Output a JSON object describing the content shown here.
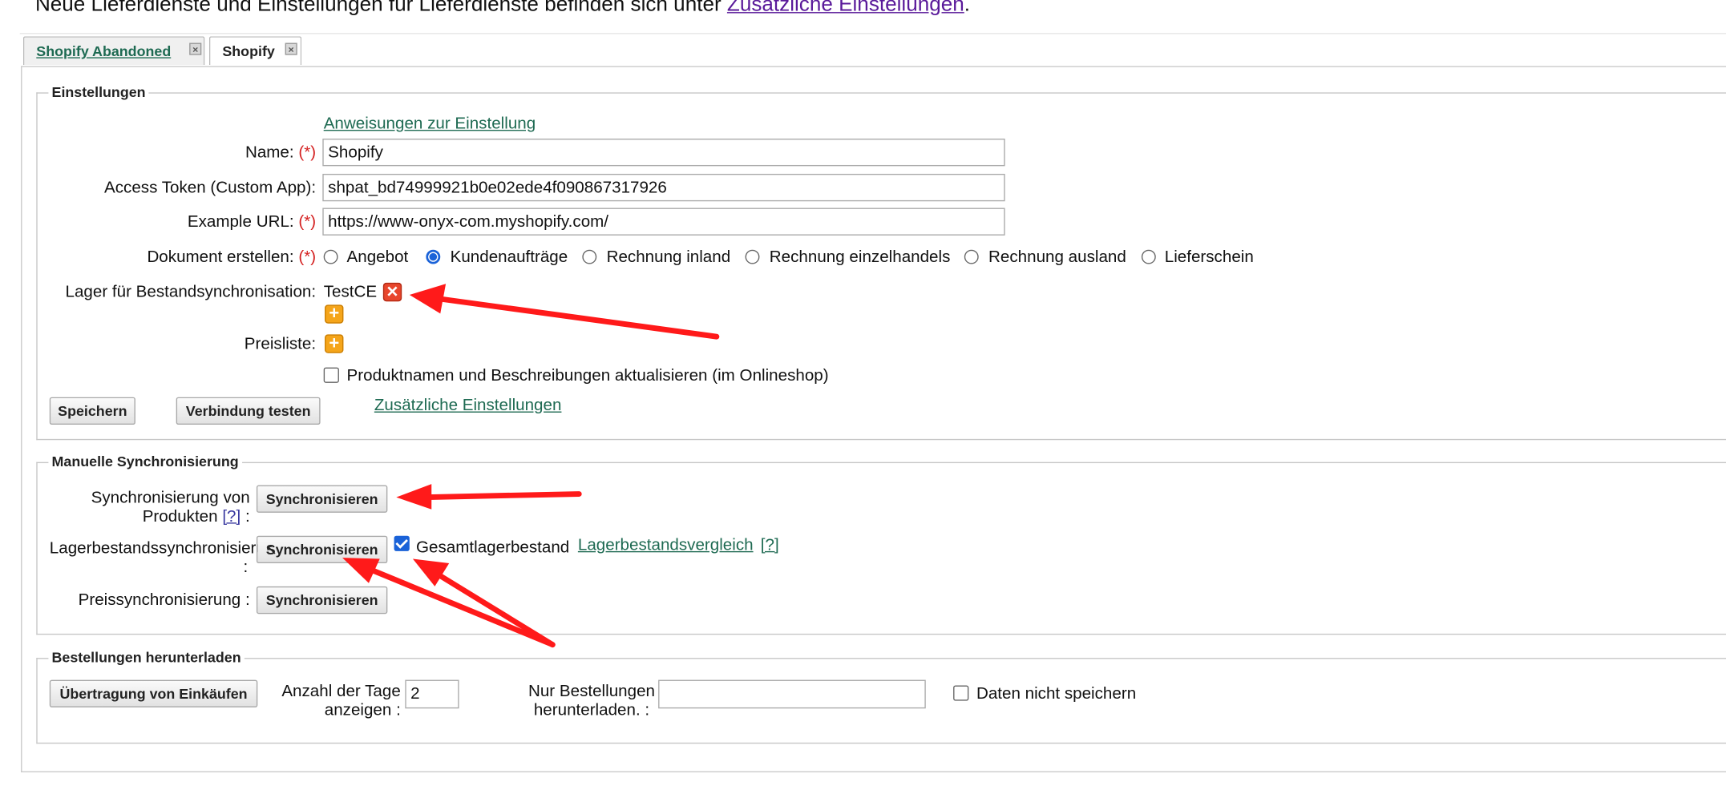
{
  "intro": {
    "text": "Neue Lieferdienste und Einstellungen für Lieferdienste befinden sich unter ",
    "link": "Zusätzliche Einstellungen",
    "suffix": "."
  },
  "tabs": [
    {
      "label": "Shopify Abandoned",
      "close": "×"
    },
    {
      "label": "Shopify",
      "close": "×"
    }
  ],
  "settings": {
    "legend": "Einstellungen",
    "instructions_link": "Anweisungen zur Einstellung",
    "name_label": "Name:",
    "name_value": "Shopify",
    "token_label": "Access Token (Custom App):",
    "token_value": "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",
    "url_label": "Example URL:",
    "url_value": "https://www-onyx-com.myshopify.com/",
    "required_mark": "(*)",
    "document_label": "Dokument erstellen:",
    "document_options": [
      "Angebot",
      "Kundenaufträge",
      "Rechnung inland",
      "Rechnung einzelhandels",
      "Rechnung ausland",
      "Lieferschein"
    ],
    "document_selected": "Kundenaufträge",
    "warehouse_label": "Lager für Bestandsynchronisation:",
    "warehouse_value": "TestCE",
    "pricelist_label": "Preisliste:",
    "update_names_label": "Produktnamen und Beschreibungen aktualisieren (im Onlineshop)",
    "update_names_checked": false,
    "save_button": "Speichern",
    "test_button": "Verbindung testen",
    "extra_settings_link": "Zusätzliche Einstellungen",
    "remove_glyph": "✕",
    "add_glyph": "+"
  },
  "manual_sync": {
    "legend": "Manuelle Synchronisierung",
    "products_label_1": "Synchronisierung von",
    "products_label_2": "Produkten",
    "help": "[?]",
    "colon": ":",
    "stock_label": "Lagerbestandssynchronisierung",
    "price_label": "Preissynchronisierung :",
    "sync_button": "Synchronisieren",
    "total_stock_label": "Gesamtlagerbestand",
    "total_stock_checked": true,
    "stock_compare_link": "Lagerbestandsvergleich",
    "help_link": "[?]"
  },
  "orders": {
    "legend": "Bestellungen herunterladen",
    "transfer_button": "Übertragung von Einkäufen",
    "days_label_1": "Anzahl der Tage",
    "days_label_2": "anzeigen :",
    "days_value": "2",
    "only_orders_label_1": "Nur Bestellungen",
    "only_orders_label_2": "herunterladen. :",
    "only_orders_value": "",
    "no_save_label": "Daten nicht speichern",
    "no_save_checked": false
  },
  "colors": {
    "link": "#1e6a52",
    "visited_link": "#5a1a9a",
    "required": "#d42020",
    "annotation_arrow": "#ff1a1a",
    "radio_checked": "#1a62d8"
  }
}
